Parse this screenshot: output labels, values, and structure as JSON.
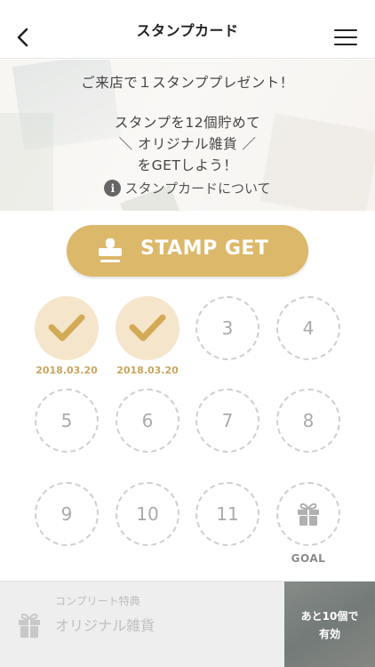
{
  "header": {
    "title": "スタンプカード"
  },
  "hero": {
    "line1": "ご来店で１スタンププレゼント！",
    "line2": "スタンプを12個貯めて",
    "line3": "＼ オリジナル雑貨 ／",
    "line4": "をGETしよう！",
    "info_icon": "i",
    "info_link": "スタンプカードについて"
  },
  "stamp_button": {
    "label": "STAMP GET"
  },
  "stamps": {
    "numbers": [
      "3",
      "4",
      "5",
      "6",
      "7",
      "8",
      "9",
      "10",
      "11"
    ],
    "dates": [
      "2018.03.20",
      "2018.03.20"
    ],
    "goal_label": "GOAL",
    "stamped_count": 2
  },
  "reward": {
    "caption": "コンプリート特典",
    "item": "オリジナル雑貨",
    "badge_line1": "あと10個で",
    "badge_line2": "有効"
  },
  "colors": {
    "accent": "#dcb86a",
    "stamp_fill": "#f5e5cb",
    "date_text": "#c9a45c"
  }
}
